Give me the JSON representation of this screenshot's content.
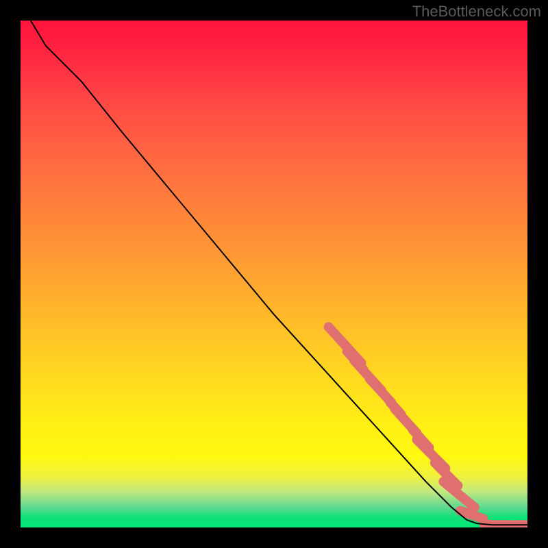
{
  "watermark": "TheBottleneck.com",
  "chart_data": {
    "type": "line",
    "title": "",
    "xlabel": "",
    "ylabel": "",
    "xlim": [
      0,
      100
    ],
    "ylim": [
      0,
      100
    ],
    "curve": [
      {
        "x": 2,
        "y": 100
      },
      {
        "x": 5,
        "y": 95
      },
      {
        "x": 8,
        "y": 92
      },
      {
        "x": 12,
        "y": 88
      },
      {
        "x": 20,
        "y": 78
      },
      {
        "x": 30,
        "y": 66
      },
      {
        "x": 40,
        "y": 54
      },
      {
        "x": 50,
        "y": 42
      },
      {
        "x": 60,
        "y": 31
      },
      {
        "x": 70,
        "y": 20
      },
      {
        "x": 80,
        "y": 9
      },
      {
        "x": 85,
        "y": 4
      },
      {
        "x": 88,
        "y": 1.5
      },
      {
        "x": 90,
        "y": 0.8
      },
      {
        "x": 93,
        "y": 0.5
      },
      {
        "x": 96,
        "y": 0.5
      },
      {
        "x": 100,
        "y": 0.5
      }
    ],
    "markers": [
      {
        "x": 64,
        "y": 36,
        "len": 6
      },
      {
        "x": 66,
        "y": 33,
        "len": 3
      },
      {
        "x": 68.5,
        "y": 30,
        "len": 5
      },
      {
        "x": 71,
        "y": 27,
        "len": 4
      },
      {
        "x": 74,
        "y": 23.5,
        "len": 2
      },
      {
        "x": 76,
        "y": 21,
        "len": 4
      },
      {
        "x": 79,
        "y": 17.5,
        "len": 3
      },
      {
        "x": 81,
        "y": 14.5,
        "len": 5
      },
      {
        "x": 84,
        "y": 10.5,
        "len": 4
      },
      {
        "x": 86.5,
        "y": 6.5,
        "len": 5
      },
      {
        "x": 89,
        "y": 2.5,
        "len": 3
      },
      {
        "x": 93,
        "y": 0.5,
        "len": 2
      },
      {
        "x": 95,
        "y": 0.5,
        "len": 2
      },
      {
        "x": 99,
        "y": 0.5,
        "len": 2
      }
    ],
    "marker_color": "#e07070"
  }
}
